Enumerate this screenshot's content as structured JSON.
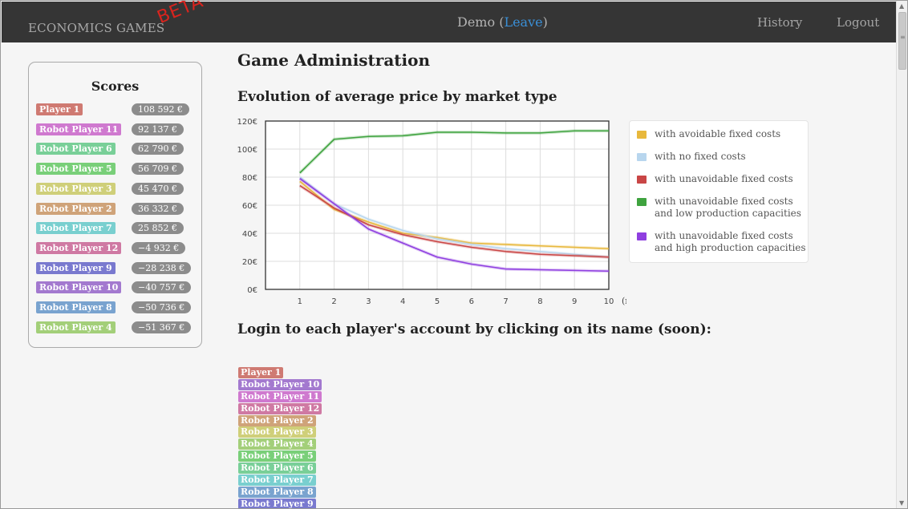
{
  "navbar": {
    "brand": "ECONOMICS GAMES",
    "beta": "BETA",
    "demo_label": "Demo (",
    "leave_label": "Leave",
    "demo_close": ")",
    "history_label": "History",
    "logout_label": "Logout"
  },
  "scores": {
    "title": "Scores",
    "rows": [
      {
        "name": "Player 1",
        "score": "108 592 €",
        "color": "#cf7a72"
      },
      {
        "name": "Robot Player 11",
        "score": "92 137 €",
        "color": "#cf79cf"
      },
      {
        "name": "Robot Player 6",
        "score": "62 790 €",
        "color": "#79cf98"
      },
      {
        "name": "Robot Player 5",
        "score": "56 709 €",
        "color": "#79cf79"
      },
      {
        "name": "Robot Player 3",
        "score": "45 470 €",
        "color": "#cfcf79"
      },
      {
        "name": "Robot Player 2",
        "score": "36 332 €",
        "color": "#cfa379"
      },
      {
        "name": "Robot Player 7",
        "score": "25 852 €",
        "color": "#79cfcf"
      },
      {
        "name": "Robot Player 12",
        "score": "−4 932 €",
        "color": "#cf79a3"
      },
      {
        "name": "Robot Player 9",
        "score": "−28 238 €",
        "color": "#7979cf"
      },
      {
        "name": "Robot Player 10",
        "score": "−40 757 €",
        "color": "#a379cf"
      },
      {
        "name": "Robot Player 8",
        "score": "−50 736 €",
        "color": "#79a3cf"
      },
      {
        "name": "Robot Player 4",
        "score": "−51 367 €",
        "color": "#a3cf79"
      }
    ]
  },
  "main": {
    "page_title": "Game Administration",
    "chart_title": "Evolution of average price by market type",
    "login_title": "Login to each player's account by clicking on its name (soon):",
    "login_players": [
      {
        "name": "Player 1",
        "color": "#cf7a72"
      },
      {
        "name": "Robot Player 10",
        "color": "#a379cf"
      },
      {
        "name": "Robot Player 11",
        "color": "#cf79cf"
      },
      {
        "name": "Robot Player 12",
        "color": "#cf79a3"
      },
      {
        "name": "Robot Player 2",
        "color": "#cfa379"
      },
      {
        "name": "Robot Player 3",
        "color": "#cfcf79"
      },
      {
        "name": "Robot Player 4",
        "color": "#a3cf79"
      },
      {
        "name": "Robot Player 5",
        "color": "#79cf79"
      },
      {
        "name": "Robot Player 6",
        "color": "#79cf98"
      },
      {
        "name": "Robot Player 7",
        "color": "#79cfcf"
      },
      {
        "name": "Robot Player 8",
        "color": "#79a3cf"
      },
      {
        "name": "Robot Player 9",
        "color": "#7979cf"
      }
    ]
  },
  "chart_data": {
    "type": "line",
    "title": "Evolution of average price by market type",
    "xlabel": "(round)",
    "ylabel": "",
    "x": [
      1,
      2,
      3,
      4,
      5,
      6,
      7,
      8,
      9,
      10
    ],
    "xlim": [
      0,
      10
    ],
    "ylim": [
      0,
      120
    ],
    "y_ticks": [
      "0€",
      "20€",
      "40€",
      "60€",
      "80€",
      "100€",
      "120€"
    ],
    "grid": true,
    "legend_position": "right",
    "series": [
      {
        "name": "with avoidable fixed costs",
        "color": "#e8b83c",
        "values": [
          77,
          57,
          48,
          40,
          37,
          33,
          32,
          31,
          30,
          29
        ]
      },
      {
        "name": "with no fixed costs",
        "color": "#b8d6ee",
        "values": [
          80,
          61,
          50,
          42,
          36,
          32,
          29,
          27,
          25,
          23
        ]
      },
      {
        "name": "with unavoidable fixed costs",
        "color": "#c94646",
        "values": [
          74,
          58,
          46,
          39,
          34,
          30,
          27,
          25,
          24,
          23
        ]
      },
      {
        "name": "with unavoidable fixed costs and low production capacities",
        "color": "#3fa33f",
        "values": [
          83,
          107,
          109,
          109.5,
          112,
          112,
          111.5,
          111.5,
          113,
          113
        ]
      },
      {
        "name": "with unavoidable fixed costs and high production capacities",
        "color": "#8f3fe0",
        "values": [
          79,
          61,
          43,
          33,
          23,
          18,
          14.5,
          14,
          13.5,
          13
        ]
      }
    ]
  }
}
